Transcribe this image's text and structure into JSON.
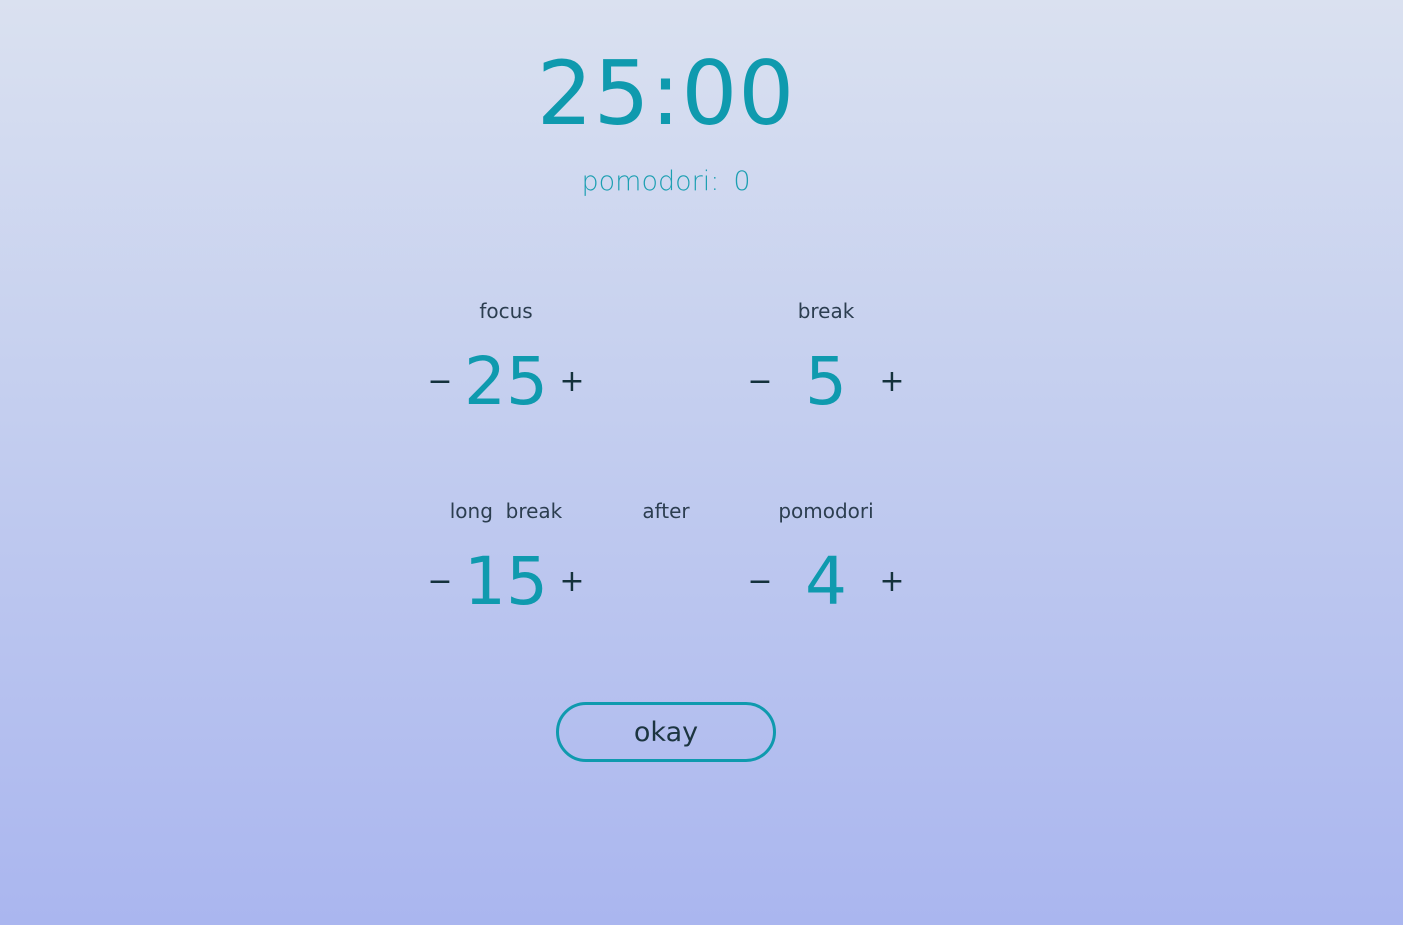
{
  "timer": {
    "display": "25:00"
  },
  "counter": {
    "label": "pomodori:",
    "value": "0"
  },
  "settings": {
    "focus": {
      "label": "focus",
      "value": "25",
      "minus": "−",
      "plus": "+"
    },
    "break": {
      "label": "break",
      "value": "5",
      "minus": "−",
      "plus": "+"
    },
    "long_break": {
      "label": "long  break",
      "value": "15",
      "minus": "−",
      "plus": "+"
    },
    "after_label": "after",
    "pomodori": {
      "label": "pomodori",
      "value": "4",
      "minus": "−",
      "plus": "+"
    }
  },
  "okay_label": "okay",
  "colors": {
    "accent": "#0f9aae",
    "text_dark": "#2c3e50"
  }
}
